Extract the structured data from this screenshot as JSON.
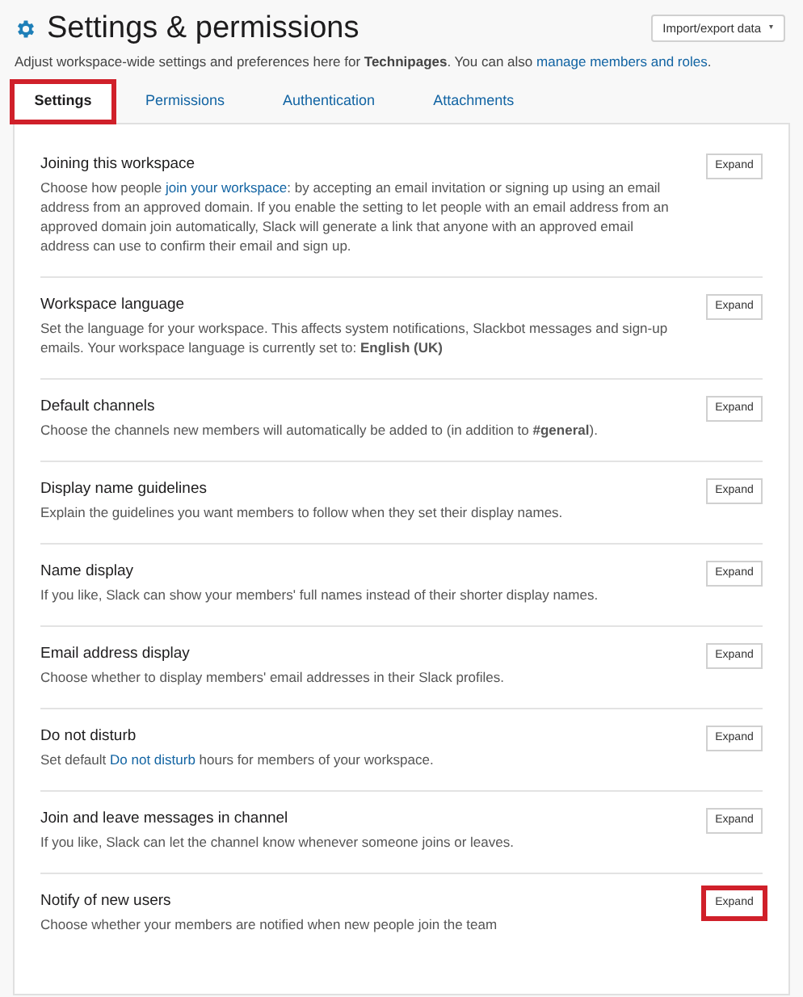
{
  "header": {
    "title": "Settings & permissions",
    "import_button": "Import/export data",
    "import_caret": "▾",
    "subtitle": [
      {
        "kind": "text",
        "text": "Adjust workspace-wide settings and preferences here for **Technipages**. You can also "
      },
      {
        "kind": "link",
        "text": "manage members and roles"
      },
      {
        "kind": "text",
        "text": "."
      }
    ]
  },
  "tabs": [
    {
      "label": "Settings",
      "selected": true,
      "highlighted": true
    },
    {
      "label": "Permissions",
      "selected": false,
      "highlighted": false
    },
    {
      "label": "Authentication",
      "selected": false,
      "highlighted": false
    },
    {
      "label": "Attachments",
      "selected": false,
      "highlighted": false
    }
  ],
  "settings": [
    {
      "title": "Joining this workspace",
      "button": "Expand",
      "highlighted": false,
      "description": [
        {
          "kind": "text",
          "text": "Choose how people "
        },
        {
          "kind": "link",
          "text": "join your workspace"
        },
        {
          "kind": "text",
          "text": ": by accepting an email invitation or signing up using an email address from an approved domain. If you enable the setting to let people with an email address from an approved domain join automatically, Slack will generate a link that anyone with an approved email address can use to confirm their email and sign up."
        }
      ]
    },
    {
      "title": "Workspace language",
      "button": "Expand",
      "highlighted": false,
      "description": [
        {
          "kind": "text",
          "text": "Set the language for your workspace. This affects system notifications, Slackbot messages and sign-up emails. Your workspace language is currently set to: **English (UK)**"
        }
      ]
    },
    {
      "title": "Default channels",
      "button": "Expand",
      "highlighted": false,
      "description": [
        {
          "kind": "text",
          "text": "Choose the channels new members will automatically be added to (in addition to **#general**)."
        }
      ]
    },
    {
      "title": "Display name guidelines",
      "button": "Expand",
      "highlighted": false,
      "description": [
        {
          "kind": "text",
          "text": "Explain the guidelines you want members to follow when they set their display names."
        }
      ]
    },
    {
      "title": "Name display",
      "button": "Expand",
      "highlighted": false,
      "description": [
        {
          "kind": "text",
          "text": "If you like, Slack can show your members' full names instead of their shorter display names."
        }
      ]
    },
    {
      "title": "Email address display",
      "button": "Expand",
      "highlighted": false,
      "description": [
        {
          "kind": "text",
          "text": "Choose whether to display members' email addresses in their Slack profiles."
        }
      ]
    },
    {
      "title": "Do not disturb",
      "button": "Expand",
      "highlighted": false,
      "description": [
        {
          "kind": "text",
          "text": "Set default "
        },
        {
          "kind": "link",
          "text": "Do not disturb"
        },
        {
          "kind": "text",
          "text": " hours for members of your workspace."
        }
      ]
    },
    {
      "title": "Join and leave messages in channel",
      "button": "Expand",
      "highlighted": false,
      "description": [
        {
          "kind": "text",
          "text": "If you like, Slack can let the channel know whenever someone joins or leaves."
        }
      ]
    },
    {
      "title": "Notify of new users",
      "button": "Expand",
      "highlighted": true,
      "description": [
        {
          "kind": "text",
          "text": "Choose whether your members are notified when new people join the team"
        }
      ]
    }
  ]
}
